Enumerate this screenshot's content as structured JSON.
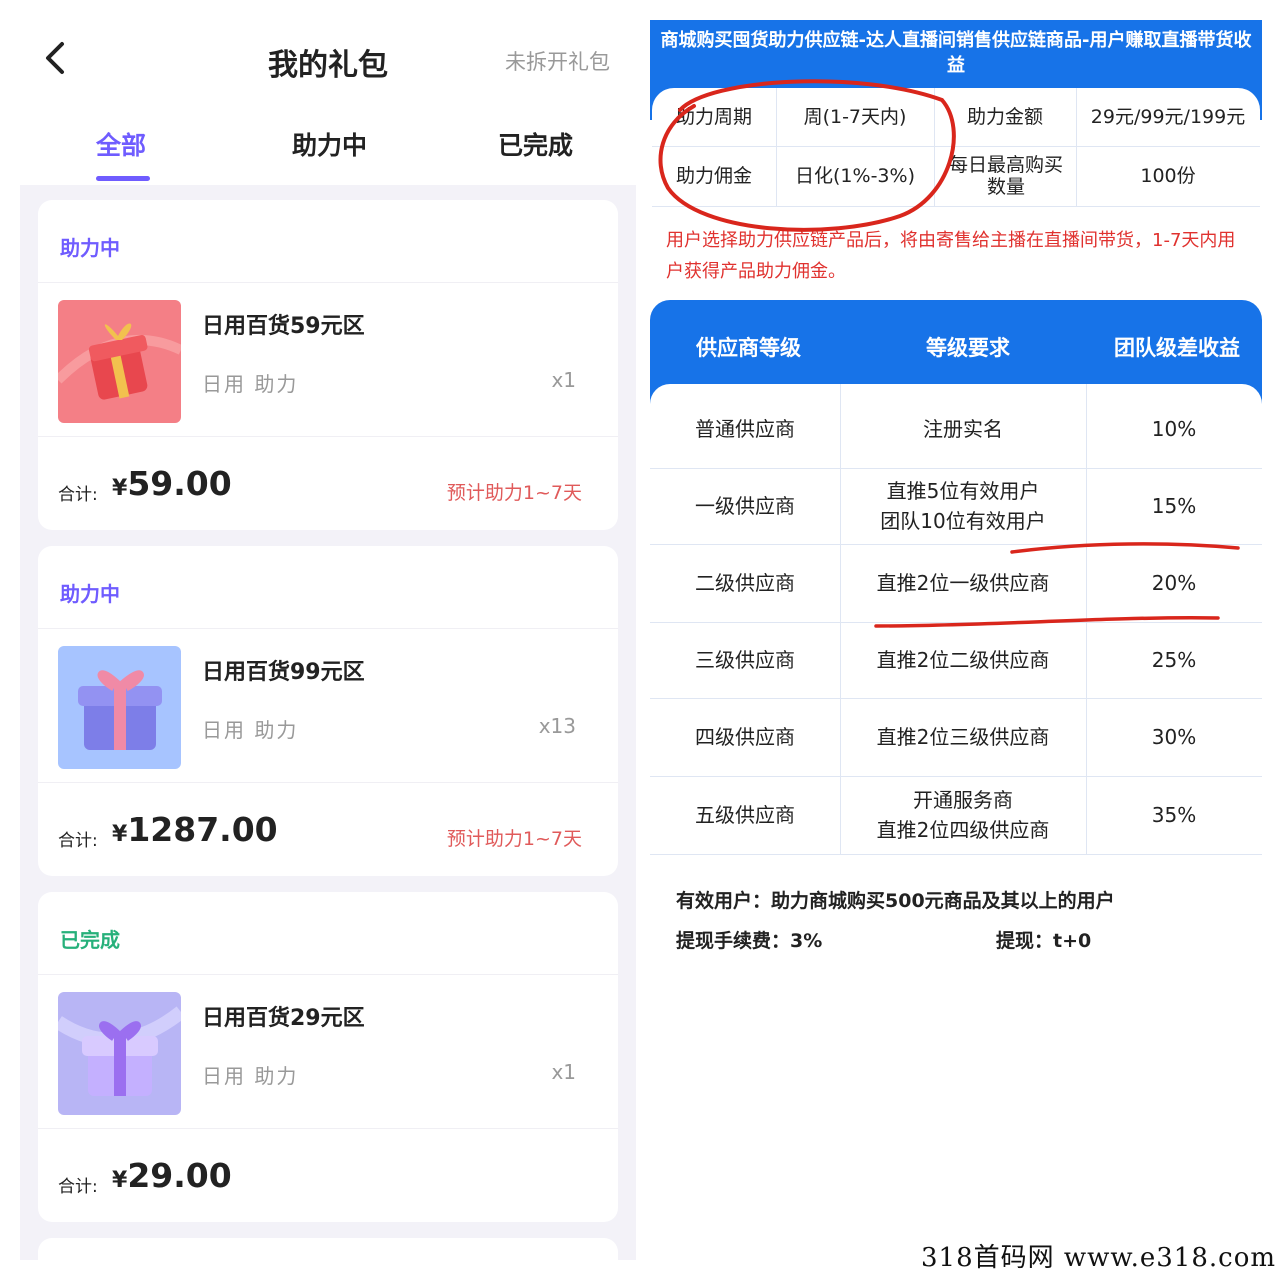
{
  "app": {
    "title": "我的礼包",
    "unopened_link": "未拆开礼包",
    "tabs": [
      {
        "label": "全部",
        "active": true
      },
      {
        "label": "助力中",
        "active": false
      },
      {
        "label": "已完成",
        "active": false
      }
    ],
    "colors": {
      "accent": "#6f5cff",
      "done": "#26b07a",
      "eta": "#e05a5a"
    },
    "orders": [
      {
        "status": "助力中",
        "name": "日用百货59元区",
        "tags": "日用  助力",
        "qty": "x1",
        "total_label": "合计:",
        "currency": "¥",
        "total": "59.00",
        "eta": "预计助力1~7天",
        "thumb_icon": "red-gift-icon"
      },
      {
        "status": "助力中",
        "name": "日用百货99元区",
        "tags": "日用  助力",
        "qty": "x13",
        "total_label": "合计:",
        "currency": "¥",
        "total": "1287.00",
        "eta": "预计助力1~7天",
        "thumb_icon": "blue-gift-icon"
      },
      {
        "status": "已完成",
        "name": "日用百货29元区",
        "tags": "日用  助力",
        "qty": "x1",
        "total_label": "合计:",
        "currency": "¥",
        "total": "29.00",
        "eta": "",
        "thumb_icon": "purple-gift-icon"
      }
    ]
  },
  "info": {
    "header": "商城购买囤货助力供应链-达人直播间销售供应链商品-用户赚取直播带货收益",
    "kv": {
      "period_label": "助力周期",
      "period_value": "周(1-7天内)",
      "amount_label": "助力金额",
      "amount_value": "29元/99元/199元",
      "commission_label": "助力佣金",
      "commission_value": "日化(1%-3%)",
      "maxbuy_label": "每日最高购买数量",
      "maxbuy_value": "100份"
    },
    "note": "用户选择助力供应链产品后，将由寄售给主播在直播间带货，1-7天内用户获得产品助力佣金。",
    "table": {
      "headers": [
        "供应商等级",
        "等级要求",
        "团队级差收益"
      ],
      "rows": [
        {
          "level": "普通供应商",
          "req": "注册实名",
          "rate": "10%"
        },
        {
          "level": "一级供应商",
          "req": "直推5位有效用户\n团队10位有效用户",
          "rate": "15%"
        },
        {
          "level": "二级供应商",
          "req": "直推2位一级供应商",
          "rate": "20%"
        },
        {
          "level": "三级供应商",
          "req": "直推2位二级供应商",
          "rate": "25%"
        },
        {
          "level": "四级供应商",
          "req": "直推2位三级供应商",
          "rate": "30%"
        },
        {
          "level": "五级供应商",
          "req": "开通服务商\n直推2位四级供应商",
          "rate": "35%"
        }
      ]
    },
    "valid_user": "有效用户：助力商城购买500元商品及其以上的用户",
    "fee": "提现手续费：3%",
    "withdraw": "提现：t+0",
    "colors": {
      "header": "#1773e8",
      "note": "#e0322f",
      "annotation": "#d9261c"
    }
  },
  "watermark": "318首码网  www.e318.com"
}
